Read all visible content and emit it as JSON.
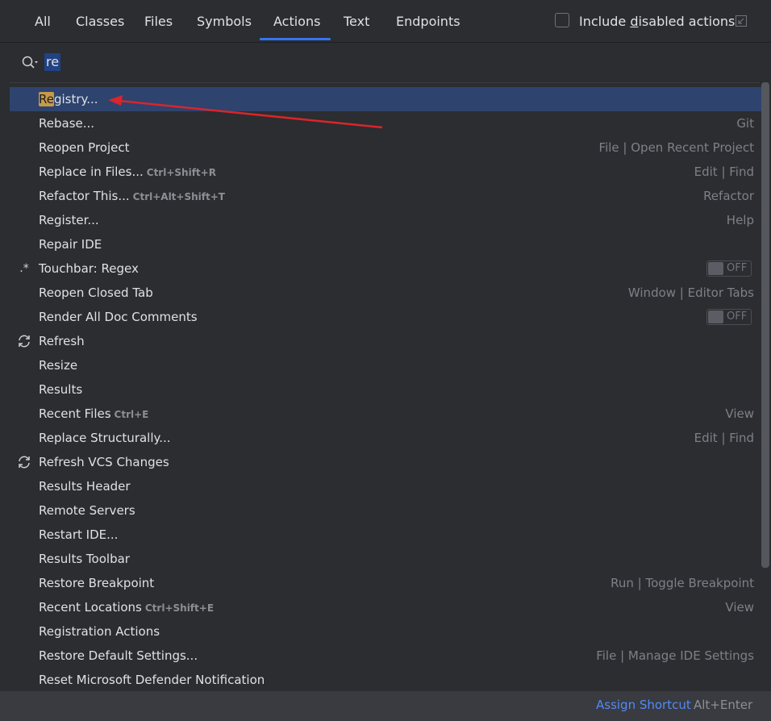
{
  "tabs": [
    "All",
    "Classes",
    "Files",
    "Symbols",
    "Actions",
    "Text",
    "Endpoints"
  ],
  "active_tab": "Actions",
  "include_disabled": {
    "prefix": "Include ",
    "mnemonic": "d",
    "suffix": "isabled actions",
    "checked": false
  },
  "search": {
    "value": "re"
  },
  "items": [
    {
      "label": "Registry...",
      "highlight": "Re",
      "rest": "gistry...",
      "selected": true
    },
    {
      "label": "Rebase...",
      "location": "Git"
    },
    {
      "label": "Reopen Project",
      "location": "File | Open Recent Project"
    },
    {
      "label": "Replace in Files...",
      "shortcut": "Ctrl+Shift+R",
      "location": "Edit | Find"
    },
    {
      "label": "Refactor This...",
      "shortcut": "Ctrl+Alt+Shift+T",
      "location": "Refactor"
    },
    {
      "label": "Register...",
      "location": "Help"
    },
    {
      "label": "Repair IDE"
    },
    {
      "label": "Touchbar: Regex",
      "icon": "regex-icon",
      "toggle": "OFF"
    },
    {
      "label": "Reopen Closed Tab",
      "location": "Window | Editor Tabs"
    },
    {
      "label": "Render All Doc Comments",
      "toggle": "OFF"
    },
    {
      "label": "Refresh",
      "icon": "refresh-icon"
    },
    {
      "label": "Resize"
    },
    {
      "label": "Results"
    },
    {
      "label": "Recent Files",
      "shortcut": "Ctrl+E",
      "location": "View"
    },
    {
      "label": "Replace Structurally...",
      "location": "Edit | Find"
    },
    {
      "label": "Refresh VCS Changes",
      "icon": "refresh-icon"
    },
    {
      "label": "Results Header"
    },
    {
      "label": "Remote Servers"
    },
    {
      "label": "Restart IDE..."
    },
    {
      "label": "Results Toolbar"
    },
    {
      "label": "Restore Breakpoint",
      "location": "Run | Toggle Breakpoint"
    },
    {
      "label": "Recent Locations",
      "shortcut": "Ctrl+Shift+E",
      "location": "View"
    },
    {
      "label": "Registration Actions"
    },
    {
      "label": "Restore Default Settings...",
      "location": "File | Manage IDE Settings"
    },
    {
      "label": "Reset Microsoft Defender Notification"
    }
  ],
  "footer": {
    "assign_label": "Assign Shortcut",
    "assign_shortcut": "Alt+Enter"
  },
  "colors": {
    "accent": "#3574f0",
    "selection": "#2e436e",
    "match_highlight": "#c79a4a",
    "annotation_arrow": "#d9252b"
  }
}
